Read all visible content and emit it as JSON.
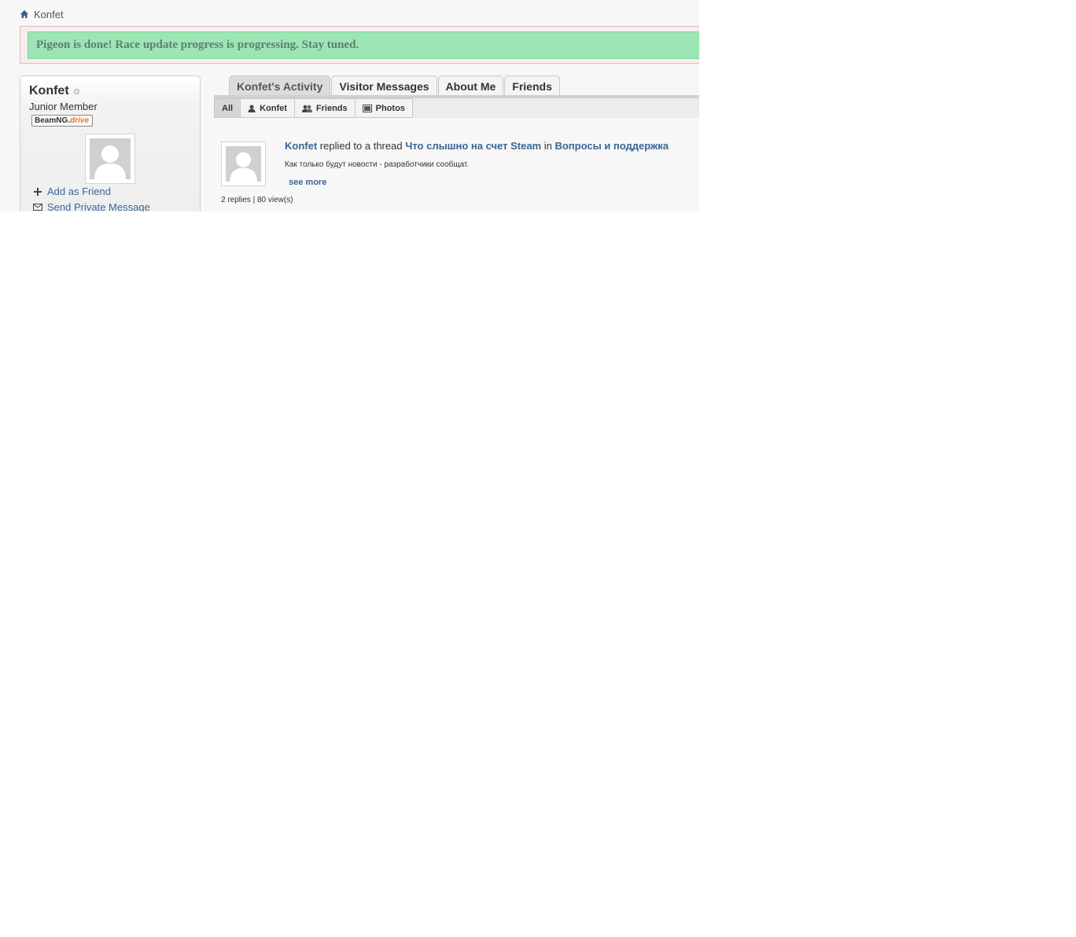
{
  "breadcrumb": {
    "icon": "home-icon",
    "label": "Konfet"
  },
  "notice": {
    "text": "Pigeon is done! Race update progress is progressing. Stay tuned."
  },
  "profile": {
    "username": "Konfet",
    "title": "Junior Member",
    "badge": {
      "prefix": "BeamNG.",
      "suffix": "drive"
    },
    "actions": {
      "add_friend": "Add as Friend",
      "send_pm": "Send Private Message"
    }
  },
  "tabs": [
    {
      "label": "Konfet's Activity"
    },
    {
      "label": "Visitor Messages"
    },
    {
      "label": "About Me"
    },
    {
      "label": "Friends"
    }
  ],
  "filters": [
    {
      "label": "All"
    },
    {
      "label": "Konfet",
      "icon": "user-icon"
    },
    {
      "label": "Friends",
      "icon": "users-icon"
    },
    {
      "label": "Photos",
      "icon": "photo-icon"
    }
  ],
  "activity": {
    "user": "Konfet",
    "action": " replied to a thread ",
    "thread": "Что слышно на счет Steam",
    "in": " in ",
    "forum": "Вопросы и поддержка",
    "snippet": "Как только будут новости - разработчики сообщат.",
    "see_more": "see more",
    "stats": "2 replies | 80 view(s)"
  },
  "colors": {
    "notice_bg": "#9be6b4",
    "link": "#3b6596",
    "accent_orange": "#e8762c"
  }
}
